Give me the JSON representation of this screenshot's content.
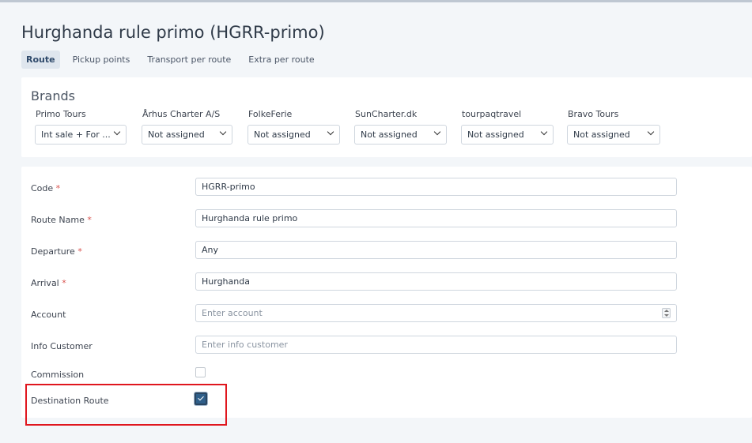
{
  "page": {
    "title": "Hurghanda rule primo (HGRR-primo)"
  },
  "tabs": [
    {
      "label": "Route",
      "active": true
    },
    {
      "label": "Pickup points",
      "active": false
    },
    {
      "label": "Transport per route",
      "active": false
    },
    {
      "label": "Extra per route",
      "active": false
    }
  ],
  "brands": {
    "title": "Brands",
    "items": [
      {
        "label": "Primo Tours",
        "value": "Int sale + For ..."
      },
      {
        "label": "Århus Charter A/S",
        "value": "Not assigned"
      },
      {
        "label": "FolkeFerie",
        "value": "Not assigned"
      },
      {
        "label": "SunCharter.dk",
        "value": "Not assigned"
      },
      {
        "label": "tourpaqtravel",
        "value": "Not assigned"
      },
      {
        "label": "Bravo Tours",
        "value": "Not assigned"
      }
    ]
  },
  "form": {
    "code": {
      "label": "Code",
      "required_mark": "*",
      "value": "HGRR-primo"
    },
    "route_name": {
      "label": "Route Name",
      "required_mark": "*",
      "value": "Hurghanda rule primo"
    },
    "departure": {
      "label": "Departure",
      "required_mark": "*",
      "value": "Any"
    },
    "arrival": {
      "label": "Arrival",
      "required_mark": "*",
      "value": "Hurghanda"
    },
    "account": {
      "label": "Account",
      "placeholder": "Enter account"
    },
    "info_customer": {
      "label": "Info Customer",
      "placeholder": "Enter info customer"
    },
    "commission": {
      "label": "Commission",
      "checked": false
    },
    "destination_route": {
      "label": "Destination Route",
      "checked": true
    }
  },
  "colors": {
    "accent": "#2f5f8a",
    "required": "#d9534f",
    "highlight": "#e0161e"
  }
}
